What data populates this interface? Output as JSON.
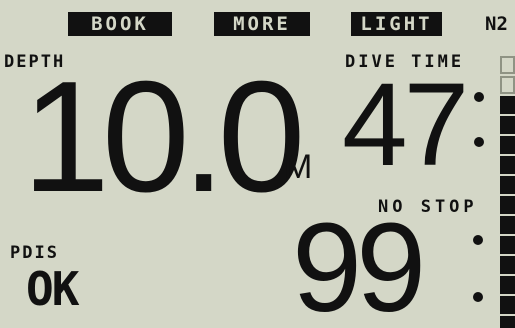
{
  "softkeys": {
    "book": "BOOK",
    "more": "MORE",
    "light": "LIGHT"
  },
  "n2_indicator": "N2",
  "depth": {
    "label": "DEPTH",
    "value": "10.0",
    "unit": "M"
  },
  "dive_time": {
    "label": "DIVE TIME",
    "value": "47"
  },
  "no_stop": {
    "label": "NO STOP",
    "value": "99"
  },
  "pdis": {
    "label": "PDIS",
    "value": "OK"
  },
  "colors": {
    "lcd_background": "#d4d7c7",
    "segment": "#111111"
  },
  "tissue_bar": {
    "segments_total": 14,
    "segments_filled": 12
  }
}
